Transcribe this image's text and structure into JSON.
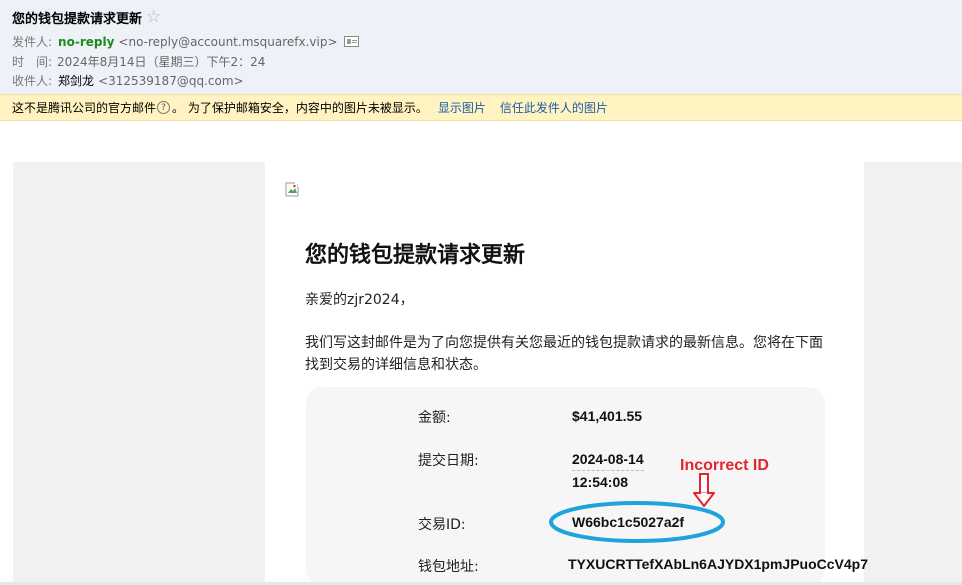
{
  "header": {
    "subject": "您的钱包提款请求更新",
    "from_label": "发件人:",
    "from_name": "no-reply",
    "from_addr": "<no-reply@account.msquarefx.vip>",
    "time_label": "时　间:",
    "time_value": "2024年8月14日（星期三）下午2：24",
    "to_label": "收件人:",
    "to_name": "郑剑龙",
    "to_addr": "<312539187@qq.com>"
  },
  "warning": {
    "text_a": "这不是腾讯公司的官方邮件",
    "help_glyph": "?",
    "text_b": "。 为了保护邮箱安全，内容中的图片未被显示。",
    "show_images": "显示图片",
    "trust_sender": "信任此发件人的图片"
  },
  "email": {
    "title": "您的钱包提款请求更新",
    "greeting": "亲爱的zjr2024，",
    "body": "我们写这封邮件是为了向您提供有关您最近的钱包提款请求的最新信息。您将在下面找到交易的详细信息和状态。",
    "fields": {
      "amount_label": "金额:",
      "amount_value": "$41,401.55",
      "date_label": "提交日期:",
      "date_line1": "2024-08-14",
      "date_line2": "12:54:08",
      "txid_label": "交易ID:",
      "txid_value": "W66bc1c5027a2f",
      "wallet_label": "钱包地址:",
      "wallet_value": "TYXUCRTTefXAbLn6AJYDX1pmJPuoCcV4p7"
    }
  },
  "annotation": {
    "text": "Incorrect ID",
    "color": "#e3262d",
    "ellipse_color": "#1fa3dc"
  },
  "icons": {
    "star": "star-outline-icon",
    "contact_card": "contact-card-icon",
    "help": "help-circle-icon",
    "broken_image": "broken-image-icon"
  }
}
